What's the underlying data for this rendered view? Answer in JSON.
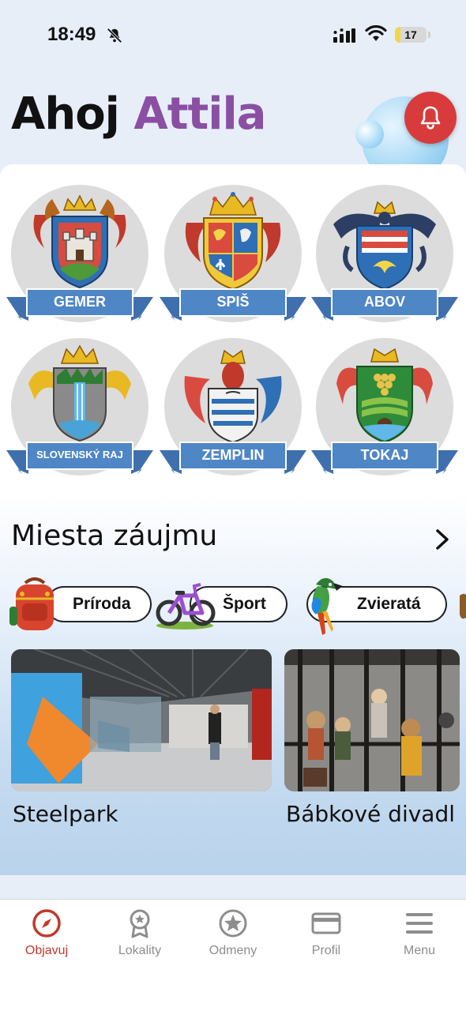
{
  "status_bar": {
    "time": "18:49",
    "battery_level": "17",
    "battery_fraction": 0.17,
    "icons": [
      "bell-muted-icon",
      "cellular-signal-icon",
      "wifi-icon",
      "battery-icon"
    ]
  },
  "header": {
    "greeting": "Ahoj",
    "user_name": "Attila",
    "notification_icon": "bell-icon"
  },
  "regions": [
    {
      "label": "GEMER",
      "icon": "gemer-crest-icon"
    },
    {
      "label": "SPIŠ",
      "icon": "spis-crest-icon"
    },
    {
      "label": "ABOV",
      "icon": "abov-crest-icon"
    },
    {
      "label": "SLOVENSKÝ RAJ",
      "icon": "slovensky-raj-crest-icon"
    },
    {
      "label": "ZEMPLIN",
      "icon": "zemplin-crest-icon"
    },
    {
      "label": "TOKAJ",
      "icon": "tokaj-crest-icon"
    }
  ],
  "points_of_interest": {
    "title": "Miesta záujmu",
    "categories": [
      {
        "label": "Príroda",
        "icon": "backpack-icon"
      },
      {
        "label": "Šport",
        "icon": "bicycle-icon"
      },
      {
        "label": "Zvieratá",
        "icon": "parrot-icon"
      }
    ],
    "places": [
      {
        "title": "Steelpark",
        "image": "steelpark-photo"
      },
      {
        "title": "Bábkové divadl",
        "image": "puppet-theatre-photo"
      }
    ]
  },
  "colors": {
    "accent": "#8a4fa3",
    "notification": "#d83b3b",
    "ribbon": "#4f86c6",
    "active_nav": "#c0392b",
    "inactive_nav": "#8d8d8d"
  },
  "bottom_nav": {
    "items": [
      {
        "label": "Objavuj",
        "icon": "compass-icon",
        "active": true
      },
      {
        "label": "Lokality",
        "icon": "medal-icon",
        "active": false
      },
      {
        "label": "Odmeny",
        "icon": "star-badge-icon",
        "active": false
      },
      {
        "label": "Profil",
        "icon": "card-icon",
        "active": false
      },
      {
        "label": "Menu",
        "icon": "hamburger-icon",
        "active": false
      }
    ]
  }
}
